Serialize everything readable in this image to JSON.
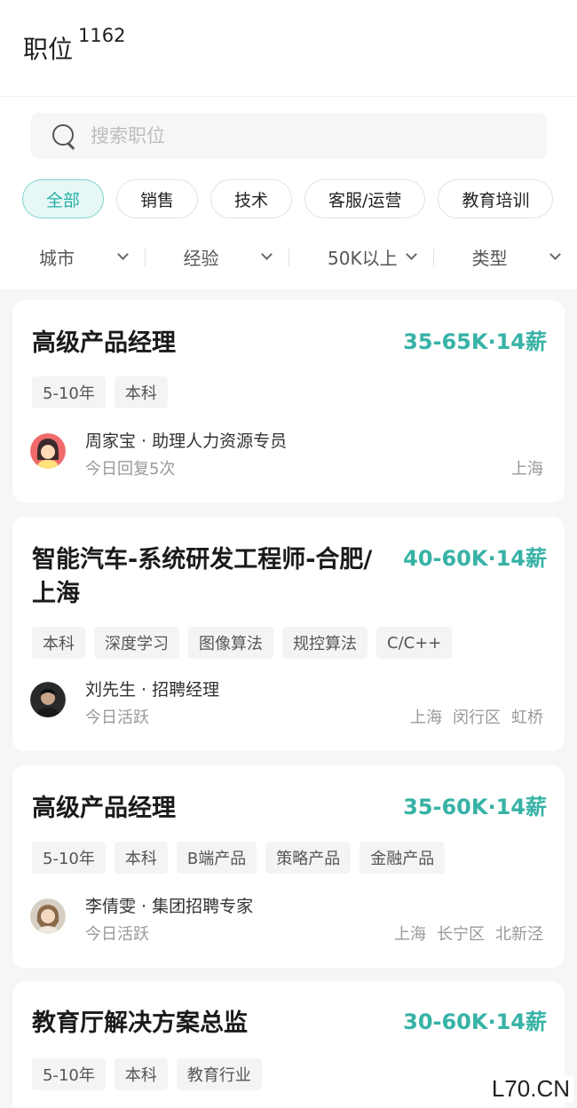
{
  "header": {
    "title": "职位",
    "count": "1162"
  },
  "search": {
    "placeholder": "搜索职位"
  },
  "categories": [
    "全部",
    "销售",
    "技术",
    "客服/运营",
    "教育培训"
  ],
  "filters": [
    "城市",
    "经验",
    "50K以上",
    "类型"
  ],
  "jobs": [
    {
      "title": "高级产品经理",
      "salary": "35-65K·14薪",
      "tags": [
        "5-10年",
        "本科"
      ],
      "recruiter": "周家宝 · 助理人力资源专员",
      "activity": "今日回复5次",
      "location": [
        "上海"
      ]
    },
    {
      "title": "智能汽车-系统研发工程师-合肥/上海",
      "salary": "40-60K·14薪",
      "tags": [
        "本科",
        "深度学习",
        "图像算法",
        "规控算法",
        "C/C++"
      ],
      "recruiter": "刘先生 · 招聘经理",
      "activity": "今日活跃",
      "location": [
        "上海",
        "闵行区",
        "虹桥"
      ]
    },
    {
      "title": "高级产品经理",
      "salary": "35-60K·14薪",
      "tags": [
        "5-10年",
        "本科",
        "B端产品",
        "策略产品",
        "金融产品"
      ],
      "recruiter": "李倩雯 · 集团招聘专家",
      "activity": "今日活跃",
      "location": [
        "上海",
        "长宁区",
        "北新泾"
      ]
    },
    {
      "title": "教育厅解决方案总监",
      "salary": "30-60K·14薪",
      "tags": [
        "5-10年",
        "本科",
        "教育行业"
      ]
    }
  ],
  "watermark": "L70.CN",
  "colors": {
    "accent": "#37b2a6",
    "chip_active_bg": "#e6f7f6"
  }
}
